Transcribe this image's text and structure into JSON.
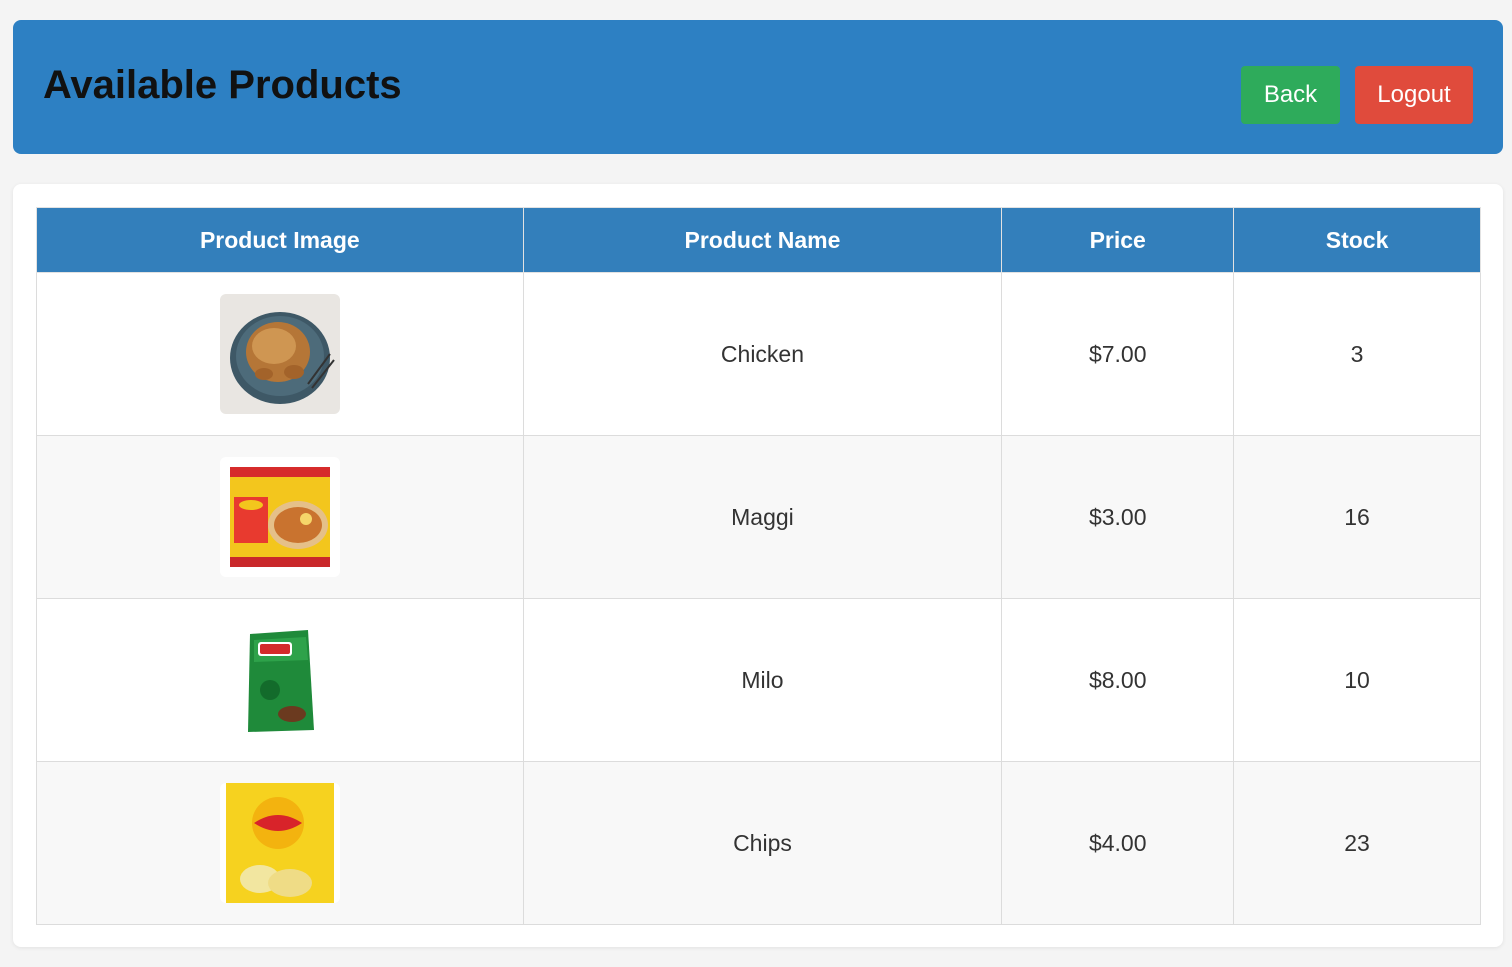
{
  "header": {
    "title": "Available Products",
    "back_label": "Back",
    "logout_label": "Logout"
  },
  "table": {
    "columns": [
      "Product Image",
      "Product Name",
      "Price",
      "Stock"
    ],
    "rows": [
      {
        "image": "roast-chicken-image",
        "name": "Chicken",
        "price": "$7.00",
        "stock": "3"
      },
      {
        "image": "maggi-noodles-image",
        "name": "Maggi",
        "price": "$3.00",
        "stock": "16"
      },
      {
        "image": "milo-pack-image",
        "name": "Milo",
        "price": "$8.00",
        "stock": "10"
      },
      {
        "image": "lays-chips-image",
        "name": "Chips",
        "price": "$4.00",
        "stock": "23"
      }
    ]
  },
  "colors": {
    "header_bg": "#2d80c3",
    "table_header_bg": "#337fbb",
    "back_button": "#2eab5b",
    "logout_button": "#e04b3c"
  }
}
